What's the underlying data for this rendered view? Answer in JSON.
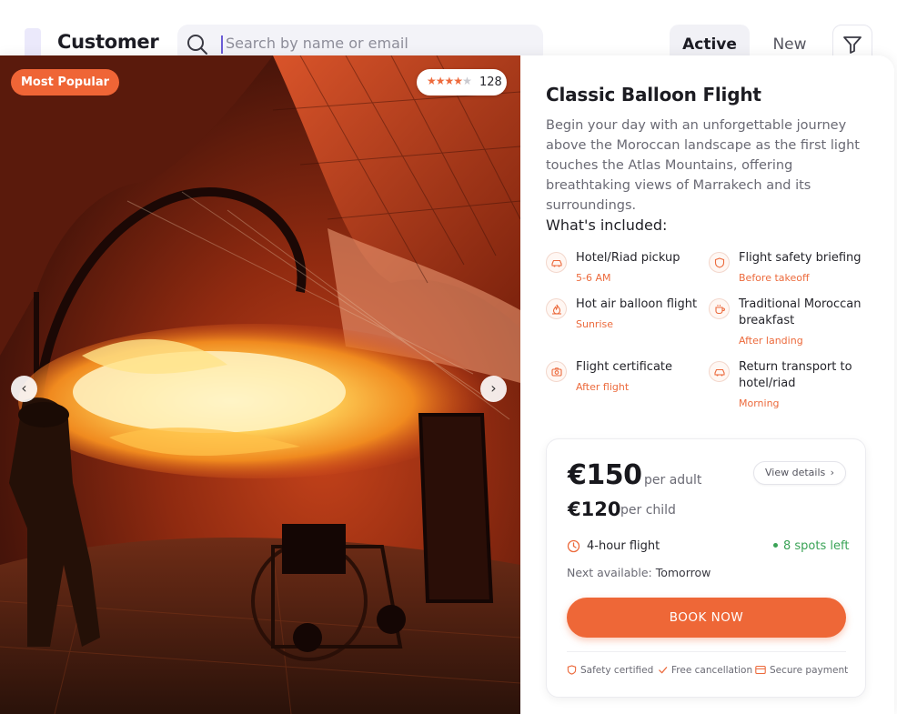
{
  "topbar": {
    "title": "Customer",
    "search_placeholder": "Search by name or email",
    "tab_active": "Active",
    "tab_new": "New"
  },
  "photo": {
    "badge": "Most Popular",
    "rating_stars": 4,
    "rating_count": "128",
    "slides_total": 4,
    "slide_active": 1
  },
  "tour": {
    "title": "Classic Balloon Flight",
    "description": "Begin your day with an unforgettable journey above the Moroccan landscape as the first light touches the Atlas Mountains, offering breathtaking views of Marrakech and its surroundings.",
    "included_heading": "What's included:",
    "included": [
      {
        "name": "Hotel/Riad pickup",
        "sub": "5-6 AM",
        "icon": "car-icon"
      },
      {
        "name": "Flight safety briefing",
        "sub": "Before takeoff",
        "icon": "shield-icon"
      },
      {
        "name": "Hot air balloon flight",
        "sub": "Sunrise",
        "icon": "flame-icon"
      },
      {
        "name": "Traditional Moroccan breakfast",
        "sub": "After landing",
        "icon": "coffee-icon"
      },
      {
        "name": "Flight certificate",
        "sub": "After flight",
        "icon": "camera-icon"
      },
      {
        "name": "Return transport to hotel/riad",
        "sub": "Morning",
        "icon": "car-icon"
      }
    ]
  },
  "booking": {
    "adult_price": "€150",
    "adult_label": "per adult",
    "child_price": "€120",
    "child_label": "per child",
    "view_details": "View details",
    "duration": "4-hour flight",
    "spots": "8 spots left",
    "next_available_label": "Next available:",
    "next_available_value": "Tomorrow",
    "book_button": "BOOK NOW",
    "trust": [
      "Safety certified",
      "Free cancellation",
      "Secure payment"
    ]
  },
  "colors": {
    "accent": "#ee6737",
    "success": "#3aa356",
    "text": "#1c1c22",
    "muted": "#6a6a74"
  }
}
